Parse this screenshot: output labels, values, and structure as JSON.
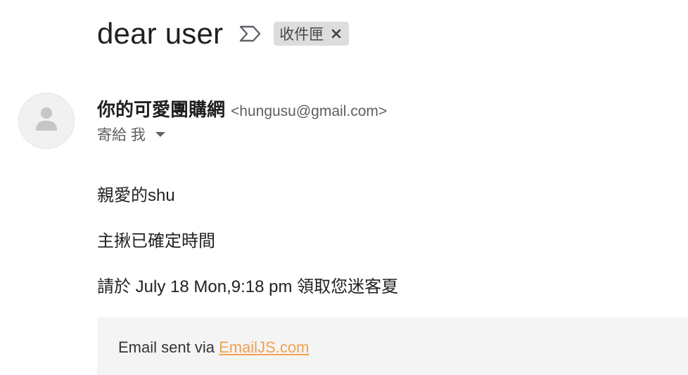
{
  "email": {
    "subject": "dear user",
    "label": "收件匣",
    "sender": {
      "name": "你的可愛團購網",
      "email": "<hungusu@gmail.com>"
    },
    "recipient_text": "寄給 我",
    "body_lines": [
      "親愛的shu",
      "主揪已確定時間",
      "請於 July 18 Mon,9:18 pm 領取您迷客夏"
    ],
    "footer": {
      "prefix": "Email sent via ",
      "link_text": "EmailJS.com"
    }
  },
  "icons": {
    "importance": "importance-marker-icon",
    "label_remove": "close-icon",
    "avatar": "person-icon",
    "details": "caret-down-icon"
  },
  "colors": {
    "link": "#f0a150",
    "chip_bg": "#dddddd",
    "footer_bg": "#f4f4f4",
    "text": "#202124"
  }
}
